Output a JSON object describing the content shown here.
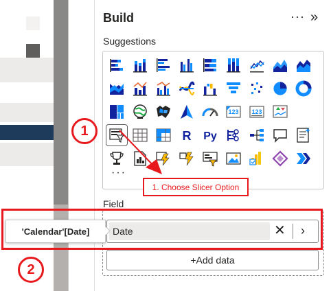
{
  "pane": {
    "title": "Build",
    "more": "···",
    "collapse": "»",
    "suggestions_label": "Suggestions",
    "field_label": "Field",
    "more_visuals": "···"
  },
  "field": {
    "value": "Date",
    "remove": "✕",
    "expand": "›",
    "add_data": "+Add data"
  },
  "tooltip": {
    "text": "'Calendar'[Date]"
  },
  "annotations": {
    "step1_number": "1",
    "step2_number": "2",
    "callout": "1. Choose Slicer Option",
    "color": "#e8191d"
  },
  "visual_icons": [
    [
      "stacked-bar-chart-icon",
      "stacked-column-chart-icon",
      "clustered-bar-chart-icon",
      "clustered-column-chart-icon",
      "100-stacked-bar-chart-icon",
      "100-stacked-column-chart-icon",
      "line-chart-icon",
      "area-chart-icon",
      "stacked-area-chart-icon"
    ],
    [
      "ribbon-chart-icon",
      "line-stacked-column-icon",
      "line-clustered-column-icon",
      "ribbon-line-icon",
      "waterfall-chart-icon",
      "funnel-chart-icon",
      "scatter-chart-icon",
      "pie-chart-icon",
      "donut-chart-icon"
    ],
    [
      "treemap-icon",
      "map-icon",
      "filled-map-icon",
      "azure-map-icon",
      "gauge-icon",
      "card-icon",
      "multi-row-card-icon",
      "kpi-icon"
    ],
    [
      "slicer-icon",
      "table-icon",
      "matrix-icon",
      "r-visual-icon",
      "python-visual-icon",
      "key-influencers-icon",
      "decomposition-tree-icon",
      "qna-icon",
      "smart-narrative-icon"
    ],
    [
      "trophy-icon",
      "paginated-report-icon",
      "power-apps-icon",
      "power-automate-icon",
      "metrics-icon",
      "image-icon",
      "power-bi-icon",
      "diamond-icon",
      "chevron-visual-icon"
    ]
  ]
}
